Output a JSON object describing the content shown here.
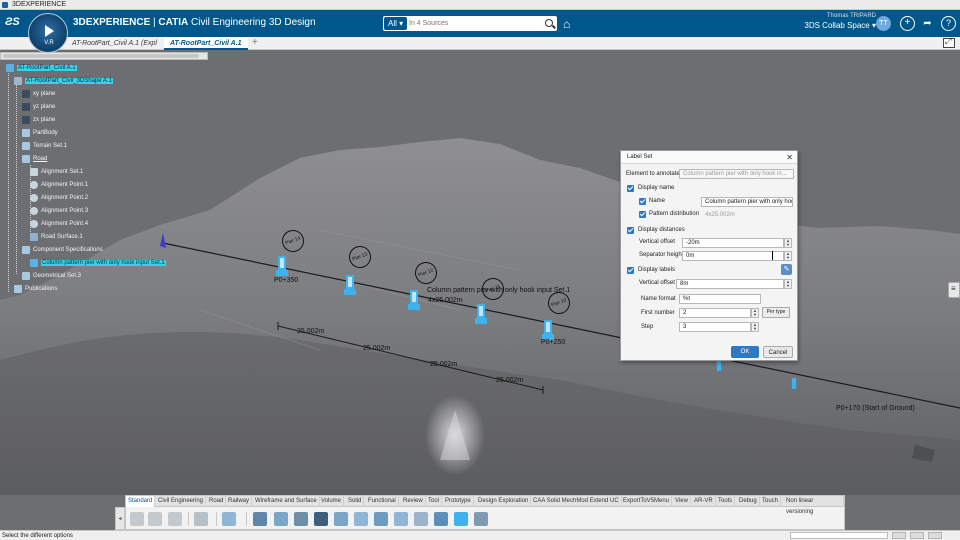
{
  "window": {
    "title": "3DEXPERIENCE"
  },
  "header": {
    "brand": "3DEXPERIENCE",
    "separator": " | ",
    "product": "CATIA",
    "app_name": " Civil Engineering 3D Design",
    "compass_version": "V.R",
    "search": {
      "scope": "All",
      "placeholder": "In 4 Sources"
    },
    "user": "Thomas TRIPARD",
    "collab_space": "3DS Collab Space",
    "avatar_initials": "TT"
  },
  "tabs": [
    {
      "label": "AT-RootPart_Civil A.1 (Expl"
    },
    {
      "label": "AT-RootPart_Civil A.1"
    }
  ],
  "tree": {
    "nodes": [
      {
        "label": "AT-RootPart_Civil A.1",
        "icon_color": "#5bb0e8"
      },
      {
        "label": "AT-RootPart_Civil_3DShape A.1",
        "icon_color": "#9fb6cc"
      },
      {
        "label": "xy plane",
        "icon_color": "#3a4c5e"
      },
      {
        "label": "yz plane",
        "icon_color": "#3a4c5e"
      },
      {
        "label": "zx plane",
        "icon_color": "#3a4c5e"
      },
      {
        "label": "PartBody",
        "icon_color": "#a9c8e0"
      },
      {
        "label": "Terrain Set.1",
        "icon_color": "#a9c8e0"
      },
      {
        "label": "Road",
        "icon_color": "#a9c8e0"
      },
      {
        "label": "Alignment Set.1",
        "icon_color": "#c8d4de"
      },
      {
        "label": "Alignment Point.1",
        "icon_color": "#c8d4de"
      },
      {
        "label": "Alignment Point.2",
        "icon_color": "#c8d4de"
      },
      {
        "label": "Alignment Point.3",
        "icon_color": "#c8d4de"
      },
      {
        "label": "Alignment Point.4",
        "icon_color": "#c8d4de"
      },
      {
        "label": "Road Surface.1",
        "icon_color": "#8fb0cc"
      },
      {
        "label": "Component Specifications",
        "icon_color": "#a9c8e0"
      },
      {
        "label": "Column pattern pier with only hook input Set.1",
        "icon_color": "#5bb0e8"
      },
      {
        "label": "Geometrical Set.3",
        "icon_color": "#a9c8e0"
      },
      {
        "label": "Publications",
        "icon_color": "#a9c8e0"
      }
    ]
  },
  "viewport_labels": {
    "p_start": "P0+350",
    "pattern_name": "Column pattern pier with only hook input Set.1",
    "distribution": "4x25.002m",
    "p_end": "P0+250",
    "ground_start": "P0+170 (Start of Ground)",
    "spans": [
      "25.002m",
      "25.002m",
      "25.002m",
      "25.002m"
    ],
    "balloons": [
      "Pier 14",
      "Pier 13",
      "Pier 12",
      "Pier 11",
      "Pier 10"
    ]
  },
  "dialog": {
    "title": "Label Set",
    "element_label": "Element to annotate",
    "element_value": "Column pattern pier with only hook in...",
    "display_name": "Display name",
    "name_label": "Name",
    "name_value": "Column pattern pier with only hoo",
    "pattern_distribution_label": "Pattern distribution",
    "pattern_distribution_value": "4x25.002m",
    "display_distances": "Display distances",
    "vertical_offset_label": "Vertical offset",
    "vertical_offset_value": "-20m",
    "separator_height_label": "Separator height",
    "separator_height_value": "0m",
    "display_labels": "Display labels",
    "labels_vertical_offset_label": "Vertical offset",
    "labels_vertical_offset_value": "8m",
    "name_format_label": "Name format",
    "name_format_value": "%t",
    "first_number_label": "First number",
    "first_number_value": "2",
    "per_type": "Per type",
    "step_label": "Step",
    "step_value": "3",
    "ok": "OK",
    "cancel": "Cancel"
  },
  "action_bar": {
    "tabs": [
      "Standard",
      "Civil Engineering",
      "Road",
      "Railway",
      "Wireframe and Surface",
      "Volume",
      "Solid",
      "Functional",
      "Review",
      "Tool",
      "Prototype",
      "Design Exploration",
      "CAA Solid MechMod Extend UC",
      "ExportToV5Menu",
      "View",
      "AR-VR",
      "Tools",
      "Debug",
      "Touch",
      "Non linear versioning"
    ]
  },
  "status": {
    "text": "Select the different options"
  }
}
